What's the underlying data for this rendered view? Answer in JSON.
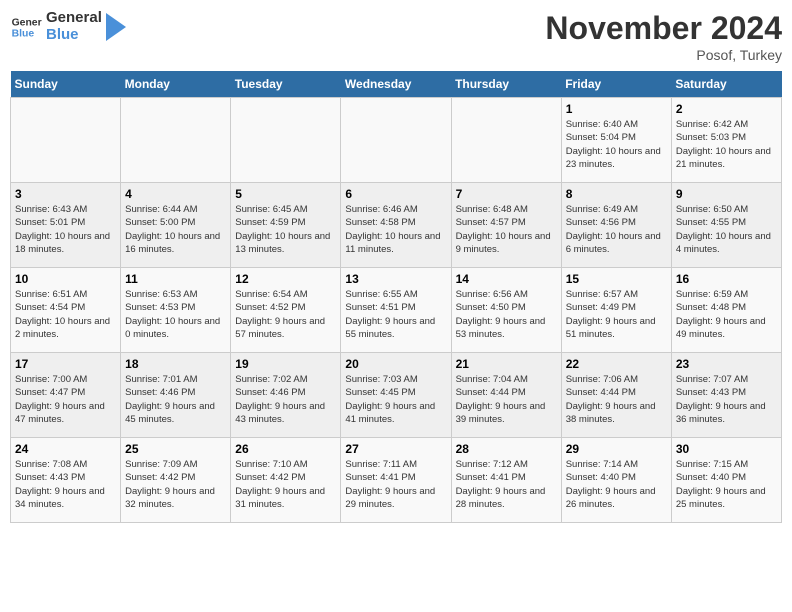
{
  "header": {
    "logo_general": "General",
    "logo_blue": "Blue",
    "month": "November 2024",
    "location": "Posof, Turkey"
  },
  "days_of_week": [
    "Sunday",
    "Monday",
    "Tuesday",
    "Wednesday",
    "Thursday",
    "Friday",
    "Saturday"
  ],
  "weeks": [
    [
      {
        "day": "",
        "info": ""
      },
      {
        "day": "",
        "info": ""
      },
      {
        "day": "",
        "info": ""
      },
      {
        "day": "",
        "info": ""
      },
      {
        "day": "",
        "info": ""
      },
      {
        "day": "1",
        "info": "Sunrise: 6:40 AM\nSunset: 5:04 PM\nDaylight: 10 hours and 23 minutes."
      },
      {
        "day": "2",
        "info": "Sunrise: 6:42 AM\nSunset: 5:03 PM\nDaylight: 10 hours and 21 minutes."
      }
    ],
    [
      {
        "day": "3",
        "info": "Sunrise: 6:43 AM\nSunset: 5:01 PM\nDaylight: 10 hours and 18 minutes."
      },
      {
        "day": "4",
        "info": "Sunrise: 6:44 AM\nSunset: 5:00 PM\nDaylight: 10 hours and 16 minutes."
      },
      {
        "day": "5",
        "info": "Sunrise: 6:45 AM\nSunset: 4:59 PM\nDaylight: 10 hours and 13 minutes."
      },
      {
        "day": "6",
        "info": "Sunrise: 6:46 AM\nSunset: 4:58 PM\nDaylight: 10 hours and 11 minutes."
      },
      {
        "day": "7",
        "info": "Sunrise: 6:48 AM\nSunset: 4:57 PM\nDaylight: 10 hours and 9 minutes."
      },
      {
        "day": "8",
        "info": "Sunrise: 6:49 AM\nSunset: 4:56 PM\nDaylight: 10 hours and 6 minutes."
      },
      {
        "day": "9",
        "info": "Sunrise: 6:50 AM\nSunset: 4:55 PM\nDaylight: 10 hours and 4 minutes."
      }
    ],
    [
      {
        "day": "10",
        "info": "Sunrise: 6:51 AM\nSunset: 4:54 PM\nDaylight: 10 hours and 2 minutes."
      },
      {
        "day": "11",
        "info": "Sunrise: 6:53 AM\nSunset: 4:53 PM\nDaylight: 10 hours and 0 minutes."
      },
      {
        "day": "12",
        "info": "Sunrise: 6:54 AM\nSunset: 4:52 PM\nDaylight: 9 hours and 57 minutes."
      },
      {
        "day": "13",
        "info": "Sunrise: 6:55 AM\nSunset: 4:51 PM\nDaylight: 9 hours and 55 minutes."
      },
      {
        "day": "14",
        "info": "Sunrise: 6:56 AM\nSunset: 4:50 PM\nDaylight: 9 hours and 53 minutes."
      },
      {
        "day": "15",
        "info": "Sunrise: 6:57 AM\nSunset: 4:49 PM\nDaylight: 9 hours and 51 minutes."
      },
      {
        "day": "16",
        "info": "Sunrise: 6:59 AM\nSunset: 4:48 PM\nDaylight: 9 hours and 49 minutes."
      }
    ],
    [
      {
        "day": "17",
        "info": "Sunrise: 7:00 AM\nSunset: 4:47 PM\nDaylight: 9 hours and 47 minutes."
      },
      {
        "day": "18",
        "info": "Sunrise: 7:01 AM\nSunset: 4:46 PM\nDaylight: 9 hours and 45 minutes."
      },
      {
        "day": "19",
        "info": "Sunrise: 7:02 AM\nSunset: 4:46 PM\nDaylight: 9 hours and 43 minutes."
      },
      {
        "day": "20",
        "info": "Sunrise: 7:03 AM\nSunset: 4:45 PM\nDaylight: 9 hours and 41 minutes."
      },
      {
        "day": "21",
        "info": "Sunrise: 7:04 AM\nSunset: 4:44 PM\nDaylight: 9 hours and 39 minutes."
      },
      {
        "day": "22",
        "info": "Sunrise: 7:06 AM\nSunset: 4:44 PM\nDaylight: 9 hours and 38 minutes."
      },
      {
        "day": "23",
        "info": "Sunrise: 7:07 AM\nSunset: 4:43 PM\nDaylight: 9 hours and 36 minutes."
      }
    ],
    [
      {
        "day": "24",
        "info": "Sunrise: 7:08 AM\nSunset: 4:43 PM\nDaylight: 9 hours and 34 minutes."
      },
      {
        "day": "25",
        "info": "Sunrise: 7:09 AM\nSunset: 4:42 PM\nDaylight: 9 hours and 32 minutes."
      },
      {
        "day": "26",
        "info": "Sunrise: 7:10 AM\nSunset: 4:42 PM\nDaylight: 9 hours and 31 minutes."
      },
      {
        "day": "27",
        "info": "Sunrise: 7:11 AM\nSunset: 4:41 PM\nDaylight: 9 hours and 29 minutes."
      },
      {
        "day": "28",
        "info": "Sunrise: 7:12 AM\nSunset: 4:41 PM\nDaylight: 9 hours and 28 minutes."
      },
      {
        "day": "29",
        "info": "Sunrise: 7:14 AM\nSunset: 4:40 PM\nDaylight: 9 hours and 26 minutes."
      },
      {
        "day": "30",
        "info": "Sunrise: 7:15 AM\nSunset: 4:40 PM\nDaylight: 9 hours and 25 minutes."
      }
    ]
  ]
}
